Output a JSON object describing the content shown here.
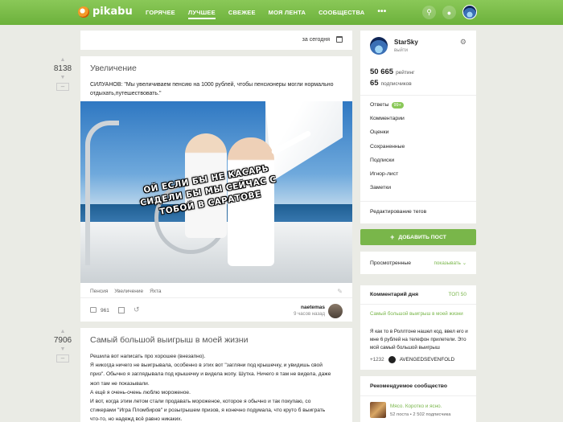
{
  "header": {
    "logo": "pikabu",
    "nav": [
      "ГОРЯЧЕЕ",
      "ЛУЧШЕЕ",
      "СВЕЖЕЕ",
      "МОЯ ЛЕНТА",
      "СООБЩЕСТВА"
    ],
    "more": "•••",
    "icons": [
      "search-icon",
      "bell-icon"
    ],
    "colors": {
      "bar": "#6cb13b",
      "accent": "#79b64a"
    }
  },
  "sort": {
    "label": "за сегодня"
  },
  "posts": [
    {
      "rating": "8138",
      "title": "Увеличение",
      "text": "СИЛУАНОВ: \"Мы увеличиваем пенсию на 1000 рублей, чтобы пенсионеры могли нормально отдыхать,путешествовать.\"",
      "image_caption": "ОЙ ЕСЛИ БЫ НЕ КАСАРЬ СИДЕЛИ БЫ МЫ СЕЙЧАС С ТОБОЙ В САРАТОВЕ",
      "tags": [
        "Пенсия",
        "Увеличение",
        "Яхта"
      ],
      "comments": "961",
      "author": "naetemas",
      "time": "9 часов назад"
    },
    {
      "rating": "7906",
      "title": "Самый большой выигрыш в моей жизни",
      "lines": [
        "Решила вот написать про хорошее (внезапно).",
        "Я никогда ничего не выигрывала, особенно в этих вот \"загляни под крышечку, и увидишь свой",
        "приз\". Обычно я заглядывала под крышечку и видела жопу. Шутка. Ничего я там не видела, даже",
        "жоп там не показывали.",
        "А ещё я очень-очень люблю мороженое.",
        "И вот, когда этим летом стали продавать мороженое, которое я обычно и так покупаю, со",
        "стикерами \"Игра Пломбиров\" и розыгрышем призов, я конечно подумала, что круто б выиграть",
        "что-то, но надежд всё равно никаких."
      ]
    }
  ],
  "profile": {
    "name": "StarSky",
    "exit": "выйти",
    "rating_value": "50 665",
    "rating_label": "рейтинг",
    "subs_value": "65",
    "subs_label": "подписчиков",
    "menu": [
      "Ответы",
      "Комментарии",
      "Оценки",
      "Сохраненные",
      "Подписки",
      "Игнор-лист",
      "Заметки"
    ],
    "answers_badge": "99+",
    "tag_edit": "Редактирование тегов"
  },
  "add_post": {
    "label": "ДОБАВИТЬ ПОСТ"
  },
  "viewed": {
    "label": "Просмотренные",
    "toggle": "показывать"
  },
  "comment_of_day": {
    "heading": "Комментарий дня",
    "top": "ТОП 50",
    "post_link": "Самый большой выигрыш в моей жизни",
    "text": "Я как то в Роллтоне нашел код, ввел его и мне 6 рублей на телефон прилетели. Это мой самый большой выигрыш",
    "score": "+1232",
    "user": "AVENGEDSEVENFOLD"
  },
  "recommended": {
    "heading": "Рекомендуемое сообщество",
    "name": "Мясо. Коротко и ясно.",
    "posts": "52 поста",
    "subs": "2 502 подписчика"
  }
}
